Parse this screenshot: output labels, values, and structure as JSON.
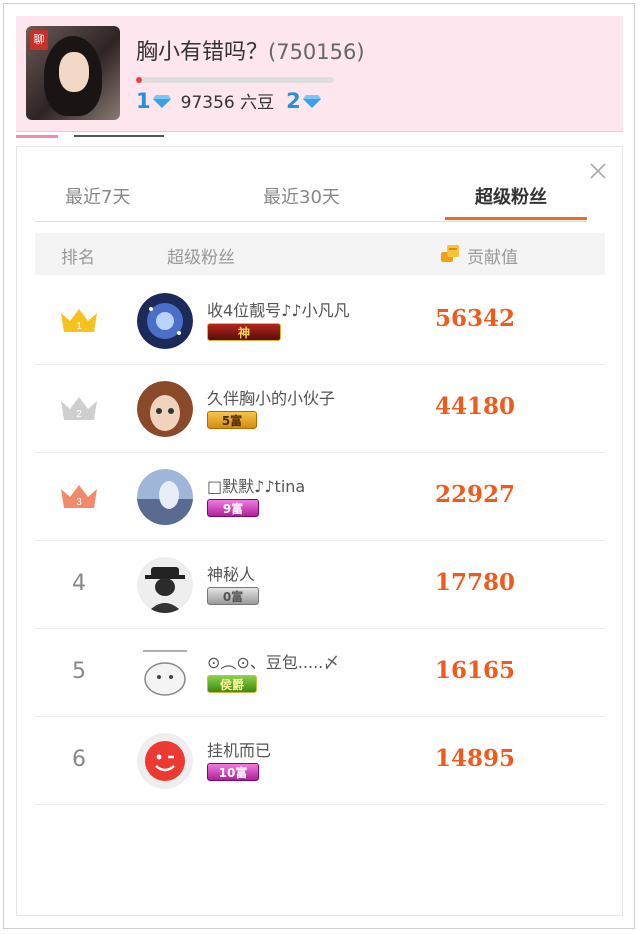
{
  "anchor": {
    "title": "胸小有错吗？",
    "room_id": "(750156)",
    "level_left": "1",
    "level_right": "2",
    "beans": "97356 六豆",
    "avatar_stamp": "聊",
    "progress": 0.03
  },
  "tabs": [
    {
      "label": "最近7天"
    },
    {
      "label": "最近30天"
    },
    {
      "label": "超级粉丝"
    }
  ],
  "table": {
    "headers": {
      "rank": "排名",
      "fans": "超级粉丝",
      "contribution": "贡献值"
    },
    "rows": [
      {
        "rank": "1",
        "name": "收4位靓号♪♪小凡凡",
        "badge": "神",
        "score": "56342",
        "avatar_icon": "galaxy-avatar-icon"
      },
      {
        "rank": "2",
        "name": "久伴胸小的小伙子",
        "badge": "5富",
        "score": "44180",
        "avatar_icon": "doll-avatar-icon"
      },
      {
        "rank": "3",
        "name": "□默默♪♪tina",
        "badge": "9富",
        "score": "22927",
        "avatar_icon": "anime-avatar-icon"
      },
      {
        "rank": "4",
        "name": "神秘人",
        "badge": "0富",
        "score": "17780",
        "avatar_icon": "mystery-avatar-icon"
      },
      {
        "rank": "5",
        "name": "⊙︵⊙、豆包.....〆",
        "badge": "侯爵",
        "score": "16165",
        "avatar_icon": "sketch-avatar-icon"
      },
      {
        "rank": "6",
        "name": "挂机而已",
        "badge": "10富",
        "score": "14895",
        "avatar_icon": "smiley-avatar-icon"
      }
    ]
  },
  "colors": {
    "accent": "#f26b1d",
    "score": "#f05a1c",
    "header_bg": "#fde6ee",
    "level": "#2c8fd6"
  }
}
